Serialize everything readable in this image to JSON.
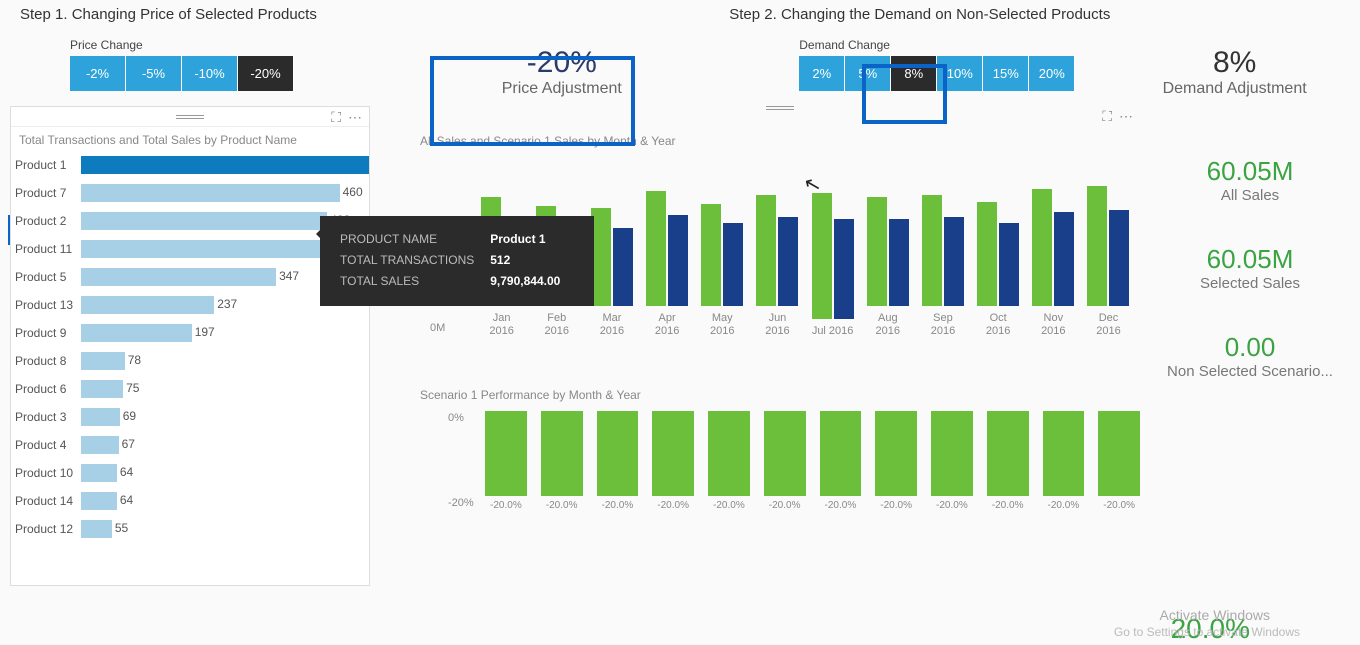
{
  "steps": {
    "step1_label": "Step 1. Changing Price of Selected Products",
    "step2_label": "Step 2. Changing the Demand on Non-Selected Products"
  },
  "price_slicer": {
    "label": "Price Change",
    "options": [
      "-2%",
      "-5%",
      "-10%",
      "-20%"
    ],
    "selected": "-20%"
  },
  "demand_slicer": {
    "label": "Demand Change",
    "options": [
      "2%",
      "5%",
      "8%",
      "10%",
      "15%",
      "20%"
    ],
    "selected": "8%"
  },
  "price_adjustment": {
    "value": "-20%",
    "label": "Price Adjustment"
  },
  "demand_adjustment": {
    "value": "8%",
    "label": "Demand Adjustment"
  },
  "kpis": {
    "all_sales": {
      "value": "60.05M",
      "label": "All Sales"
    },
    "selected_sales": {
      "value": "60.05M",
      "label": "Selected Sales"
    },
    "non_selected": {
      "value": "0.00",
      "label": "Non Selected Scenario..."
    },
    "bottom_pct": "20.0%"
  },
  "product_chart_title": "Total Transactions and Total Sales by Product Name",
  "tooltip": {
    "product_name_label": "PRODUCT NAME",
    "product_name": "Product 1",
    "transactions_label": "TOTAL TRANSACTIONS",
    "transactions": "512",
    "sales_label": "TOTAL SALES",
    "sales": "9,790,844.00"
  },
  "monthly_chart_title": "All Sales and Scenario 1 Sales by Month & Year",
  "monthly_y_label": "0M",
  "perf_chart_title": "Scenario 1 Performance by Month & Year",
  "perf_y0": "0%",
  "perf_y1": "-20%",
  "watermark1": "Activate Windows",
  "watermark2": "Go to Settings to activate Windows",
  "chart_data": [
    {
      "type": "bar",
      "title": "Total Transactions and Total Sales by Product Name",
      "orientation": "horizontal",
      "categories": [
        "Product 1",
        "Product 7",
        "Product 2",
        "Product 11",
        "Product 5",
        "Product 13",
        "Product 9",
        "Product 8",
        "Product 6",
        "Product 3",
        "Product 4",
        "Product 10",
        "Product 14",
        "Product 12"
      ],
      "values": [
        512,
        460,
        438,
        424,
        347,
        237,
        197,
        78,
        75,
        69,
        67,
        64,
        64,
        55
      ],
      "selected_index": 0
    },
    {
      "type": "bar",
      "title": "All Sales and Scenario 1 Sales by Month & Year",
      "categories": [
        "Jan 2016",
        "Feb 2016",
        "Mar 2016",
        "Apr 2016",
        "May 2016",
        "Jun 2016",
        "Jul 2016",
        "Aug 2016",
        "Sep 2016",
        "Oct 2016",
        "Nov 2016",
        "Dec 2016"
      ],
      "series": [
        {
          "name": "All Sales",
          "values": [
            5.0,
            4.6,
            4.5,
            5.3,
            4.7,
            5.1,
            5.8,
            5.0,
            5.1,
            4.8,
            5.4,
            5.5
          ],
          "color": "#6bbf3a"
        },
        {
          "name": "Scenario 1",
          "values": [
            4.0,
            3.7,
            3.6,
            4.2,
            3.8,
            4.1,
            4.6,
            4.0,
            4.1,
            3.8,
            4.3,
            4.4
          ],
          "color": "#1a3f8a"
        }
      ],
      "ylabel": "M",
      "ylim": [
        0,
        6
      ]
    },
    {
      "type": "bar",
      "title": "Scenario 1 Performance by Month & Year",
      "categories": [
        "Jan 2016",
        "Feb 2016",
        "Mar 2016",
        "Apr 2016",
        "May 2016",
        "Jun 2016",
        "Jul 2016",
        "Aug 2016",
        "Sep 2016",
        "Oct 2016",
        "Nov 2016",
        "Dec 2016"
      ],
      "values": [
        -20.0,
        -20.0,
        -20.0,
        -20.0,
        -20.0,
        -20.0,
        -20.0,
        -20.0,
        -20.0,
        -20.0,
        -20.0,
        -20.0
      ],
      "ylim": [
        -20,
        0
      ],
      "value_label": "-20.0%"
    }
  ]
}
